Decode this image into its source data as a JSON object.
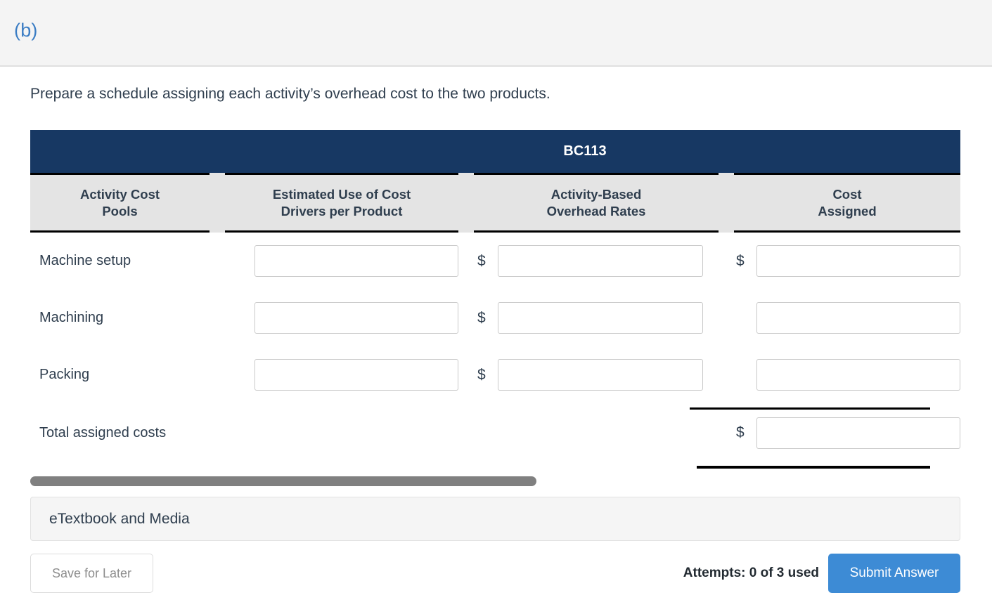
{
  "part": {
    "label": "(b)"
  },
  "prompt": "Prepare a schedule assigning each activity’s overhead cost to the two products.",
  "table": {
    "product_header": "BC113",
    "columns": [
      {
        "line1": "Activity Cost",
        "line2": "Pools"
      },
      {
        "line1": "Estimated Use of Cost",
        "line2": "Drivers per Product"
      },
      {
        "line1": "Activity-Based",
        "line2": "Overhead Rates"
      },
      {
        "line1": "Cost",
        "line2": "Assigned"
      }
    ],
    "currency_symbol": "$",
    "rows": [
      {
        "label": "Machine setup",
        "drivers_value": "",
        "rates_symbol": "$",
        "rates_value": "",
        "cost_symbol": "$",
        "cost_value": ""
      },
      {
        "label": "Machining",
        "drivers_value": "",
        "rates_symbol": "$",
        "rates_value": "",
        "cost_symbol": "",
        "cost_value": ""
      },
      {
        "label": "Packing",
        "drivers_value": "",
        "rates_symbol": "$",
        "rates_value": "",
        "cost_symbol": "",
        "cost_value": ""
      }
    ],
    "total_row": {
      "label": "Total assigned costs",
      "cost_symbol": "$",
      "cost_value": ""
    }
  },
  "etextbook": {
    "label": "eTextbook and Media"
  },
  "footer": {
    "save_label": "Save for Later",
    "attempts": "Attempts: 0 of 3 used",
    "submit_label": "Submit Answer"
  },
  "colors": {
    "navy_header": "#173863",
    "subheader_bg": "#e4e4e4",
    "accent_blue": "#3d8bd5",
    "part_label_blue": "#3b7dc4",
    "scrollbar_thumb": "#808080",
    "text": "#2f3e4e"
  }
}
